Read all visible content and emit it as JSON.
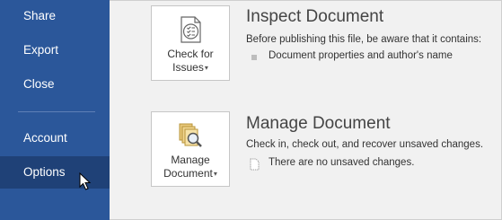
{
  "sidebar": {
    "items": [
      {
        "label": "Share"
      },
      {
        "label": "Export"
      },
      {
        "label": "Close"
      },
      {
        "label": "Account"
      },
      {
        "label": "Options"
      }
    ]
  },
  "inspect": {
    "button": {
      "line1": "Check for",
      "line2": "Issues",
      "icon": "document-check-icon"
    },
    "title": "Inspect Document",
    "description": "Before publishing this file, be aware that it contains:",
    "items": [
      "Document properties and author's name"
    ]
  },
  "manage": {
    "button": {
      "line1": "Manage",
      "line2": "Document",
      "icon": "manage-document-icon"
    },
    "title": "Manage Document",
    "description": "Check in, check out, and recover unsaved changes.",
    "items": [
      "There are no unsaved changes."
    ]
  },
  "colors": {
    "sidebar": "#2b579a",
    "sidebar_active": "#1f4177",
    "background": "#f1f1f1"
  }
}
